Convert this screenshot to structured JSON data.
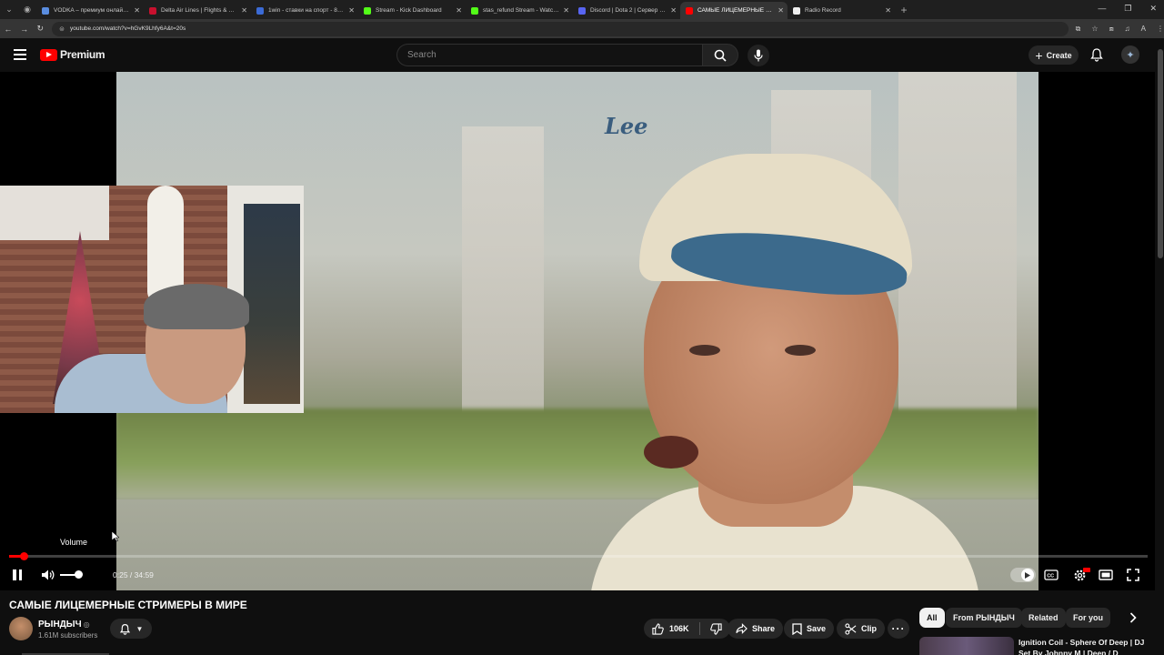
{
  "browser": {
    "tabs": [
      {
        "title": "VODKA – премиум онлайн-ка",
        "color": "#5a8de0",
        "active": false
      },
      {
        "title": "Delta Air Lines | Flights & Plane",
        "color": "#c8102e",
        "active": false
      },
      {
        "title": "1win - ставки на спорт - 8218",
        "color": "#3b6bd6",
        "active": false
      },
      {
        "title": "Stream - Kick Dashboard",
        "color": "#53fc18",
        "active": false
      },
      {
        "title": "stas_refund Stream - Watch Live",
        "color": "#53fc18",
        "active": false
      },
      {
        "title": "Discord | Dota 2 | Сервер é[Ld",
        "color": "#5865f2",
        "active": false
      },
      {
        "title": "САМЫЕ ЛИЦЕМЕРНЫЕ СТР",
        "color": "#ff0000",
        "active": true
      },
      {
        "title": "Radio Record",
        "color": "#eeeeee",
        "active": false
      }
    ],
    "url": "youtube.com/watch?v=hGvK9Lhfy6A&t=20s"
  },
  "header": {
    "logo_text": "Premium",
    "search_placeholder": "Search",
    "create_label": "Create"
  },
  "player": {
    "tooltip": "Volume",
    "current_time": "0:25",
    "duration": "34:59",
    "time_display": "0:25 / 34:59",
    "progress_fraction": 0.012,
    "volume_fraction": 0.8,
    "video_overlay_text": "Lee",
    "colors": {
      "progress": "#ff0000"
    }
  },
  "video": {
    "title": "САМЫЕ ЛИЦЕМЕРНЫЕ СТРИМЕРЫ В МИРЕ",
    "channel": "РЫНДЫЧ",
    "subscribers": "1.61M subscribers",
    "likes": "106K",
    "share_label": "Share",
    "save_label": "Save",
    "clip_label": "Clip"
  },
  "filters": {
    "chips": [
      "All",
      "From РЫНДЫЧ",
      "Related",
      "For you"
    ],
    "active": "All"
  },
  "related": {
    "first_title": "Ignition Coil - Sphere Of Deep | DJ Set By Johnny M | Deep / D"
  }
}
